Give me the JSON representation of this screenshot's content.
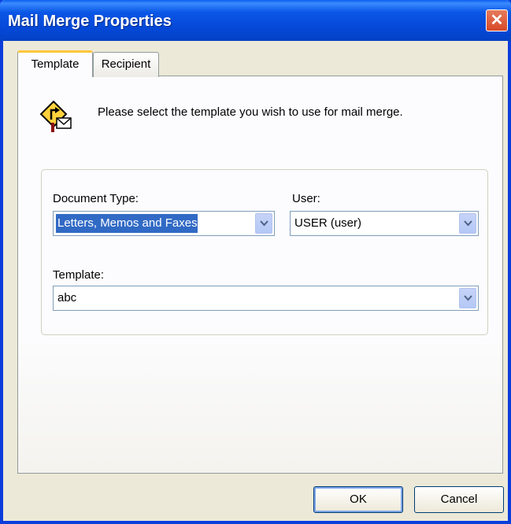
{
  "window": {
    "title": "Mail Merge Properties"
  },
  "tabs": [
    {
      "label": "Template"
    },
    {
      "label": "Recipient"
    }
  ],
  "intro_text": "Please select the template you wish to use for mail merge.",
  "form": {
    "document_type_label": "Document Type:",
    "document_type_value": "Letters, Memos and Faxes",
    "user_label": "User:",
    "user_value": "USER (user)",
    "template_label": "Template:",
    "template_value": "abc"
  },
  "buttons": {
    "ok": "OK",
    "cancel": "Cancel"
  },
  "icons": {
    "dialog_icon": "mail-merge-route-icon",
    "close": "close-icon",
    "dropdown": "chevron-down-icon"
  },
  "colors": {
    "titlebar": "#0a56e6",
    "selection": "#316ac5",
    "active_tab_accent": "#ffc83c"
  }
}
